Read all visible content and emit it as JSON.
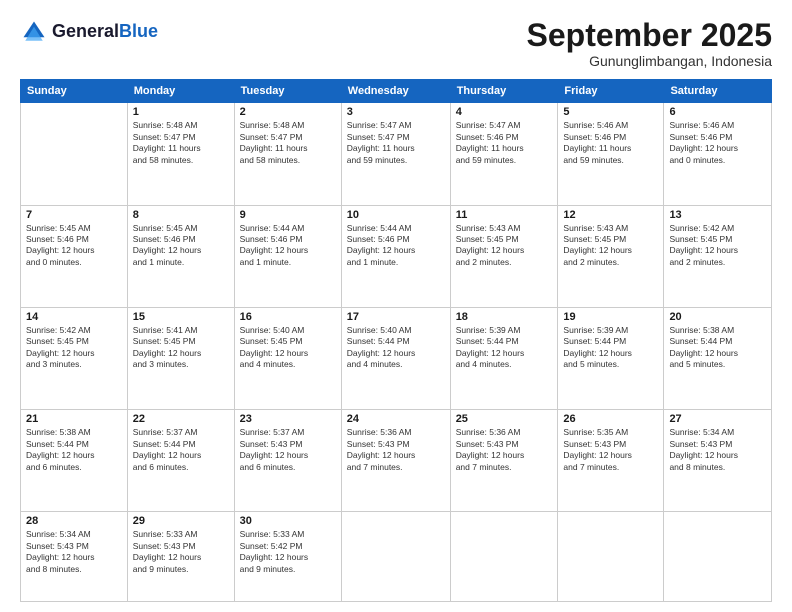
{
  "header": {
    "logo_general": "General",
    "logo_blue": "Blue",
    "month": "September 2025",
    "location": "Gununglimbangan, Indonesia"
  },
  "days_of_week": [
    "Sunday",
    "Monday",
    "Tuesday",
    "Wednesday",
    "Thursday",
    "Friday",
    "Saturday"
  ],
  "weeks": [
    [
      {
        "day": "",
        "info": ""
      },
      {
        "day": "1",
        "info": "Sunrise: 5:48 AM\nSunset: 5:47 PM\nDaylight: 11 hours\nand 58 minutes."
      },
      {
        "day": "2",
        "info": "Sunrise: 5:48 AM\nSunset: 5:47 PM\nDaylight: 11 hours\nand 58 minutes."
      },
      {
        "day": "3",
        "info": "Sunrise: 5:47 AM\nSunset: 5:47 PM\nDaylight: 11 hours\nand 59 minutes."
      },
      {
        "day": "4",
        "info": "Sunrise: 5:47 AM\nSunset: 5:46 PM\nDaylight: 11 hours\nand 59 minutes."
      },
      {
        "day": "5",
        "info": "Sunrise: 5:46 AM\nSunset: 5:46 PM\nDaylight: 11 hours\nand 59 minutes."
      },
      {
        "day": "6",
        "info": "Sunrise: 5:46 AM\nSunset: 5:46 PM\nDaylight: 12 hours\nand 0 minutes."
      }
    ],
    [
      {
        "day": "7",
        "info": "Sunrise: 5:45 AM\nSunset: 5:46 PM\nDaylight: 12 hours\nand 0 minutes."
      },
      {
        "day": "8",
        "info": "Sunrise: 5:45 AM\nSunset: 5:46 PM\nDaylight: 12 hours\nand 1 minute."
      },
      {
        "day": "9",
        "info": "Sunrise: 5:44 AM\nSunset: 5:46 PM\nDaylight: 12 hours\nand 1 minute."
      },
      {
        "day": "10",
        "info": "Sunrise: 5:44 AM\nSunset: 5:46 PM\nDaylight: 12 hours\nand 1 minute."
      },
      {
        "day": "11",
        "info": "Sunrise: 5:43 AM\nSunset: 5:45 PM\nDaylight: 12 hours\nand 2 minutes."
      },
      {
        "day": "12",
        "info": "Sunrise: 5:43 AM\nSunset: 5:45 PM\nDaylight: 12 hours\nand 2 minutes."
      },
      {
        "day": "13",
        "info": "Sunrise: 5:42 AM\nSunset: 5:45 PM\nDaylight: 12 hours\nand 2 minutes."
      }
    ],
    [
      {
        "day": "14",
        "info": "Sunrise: 5:42 AM\nSunset: 5:45 PM\nDaylight: 12 hours\nand 3 minutes."
      },
      {
        "day": "15",
        "info": "Sunrise: 5:41 AM\nSunset: 5:45 PM\nDaylight: 12 hours\nand 3 minutes."
      },
      {
        "day": "16",
        "info": "Sunrise: 5:40 AM\nSunset: 5:45 PM\nDaylight: 12 hours\nand 4 minutes."
      },
      {
        "day": "17",
        "info": "Sunrise: 5:40 AM\nSunset: 5:44 PM\nDaylight: 12 hours\nand 4 minutes."
      },
      {
        "day": "18",
        "info": "Sunrise: 5:39 AM\nSunset: 5:44 PM\nDaylight: 12 hours\nand 4 minutes."
      },
      {
        "day": "19",
        "info": "Sunrise: 5:39 AM\nSunset: 5:44 PM\nDaylight: 12 hours\nand 5 minutes."
      },
      {
        "day": "20",
        "info": "Sunrise: 5:38 AM\nSunset: 5:44 PM\nDaylight: 12 hours\nand 5 minutes."
      }
    ],
    [
      {
        "day": "21",
        "info": "Sunrise: 5:38 AM\nSunset: 5:44 PM\nDaylight: 12 hours\nand 6 minutes."
      },
      {
        "day": "22",
        "info": "Sunrise: 5:37 AM\nSunset: 5:44 PM\nDaylight: 12 hours\nand 6 minutes."
      },
      {
        "day": "23",
        "info": "Sunrise: 5:37 AM\nSunset: 5:43 PM\nDaylight: 12 hours\nand 6 minutes."
      },
      {
        "day": "24",
        "info": "Sunrise: 5:36 AM\nSunset: 5:43 PM\nDaylight: 12 hours\nand 7 minutes."
      },
      {
        "day": "25",
        "info": "Sunrise: 5:36 AM\nSunset: 5:43 PM\nDaylight: 12 hours\nand 7 minutes."
      },
      {
        "day": "26",
        "info": "Sunrise: 5:35 AM\nSunset: 5:43 PM\nDaylight: 12 hours\nand 7 minutes."
      },
      {
        "day": "27",
        "info": "Sunrise: 5:34 AM\nSunset: 5:43 PM\nDaylight: 12 hours\nand 8 minutes."
      }
    ],
    [
      {
        "day": "28",
        "info": "Sunrise: 5:34 AM\nSunset: 5:43 PM\nDaylight: 12 hours\nand 8 minutes."
      },
      {
        "day": "29",
        "info": "Sunrise: 5:33 AM\nSunset: 5:43 PM\nDaylight: 12 hours\nand 9 minutes."
      },
      {
        "day": "30",
        "info": "Sunrise: 5:33 AM\nSunset: 5:42 PM\nDaylight: 12 hours\nand 9 minutes."
      },
      {
        "day": "",
        "info": ""
      },
      {
        "day": "",
        "info": ""
      },
      {
        "day": "",
        "info": ""
      },
      {
        "day": "",
        "info": ""
      }
    ]
  ]
}
